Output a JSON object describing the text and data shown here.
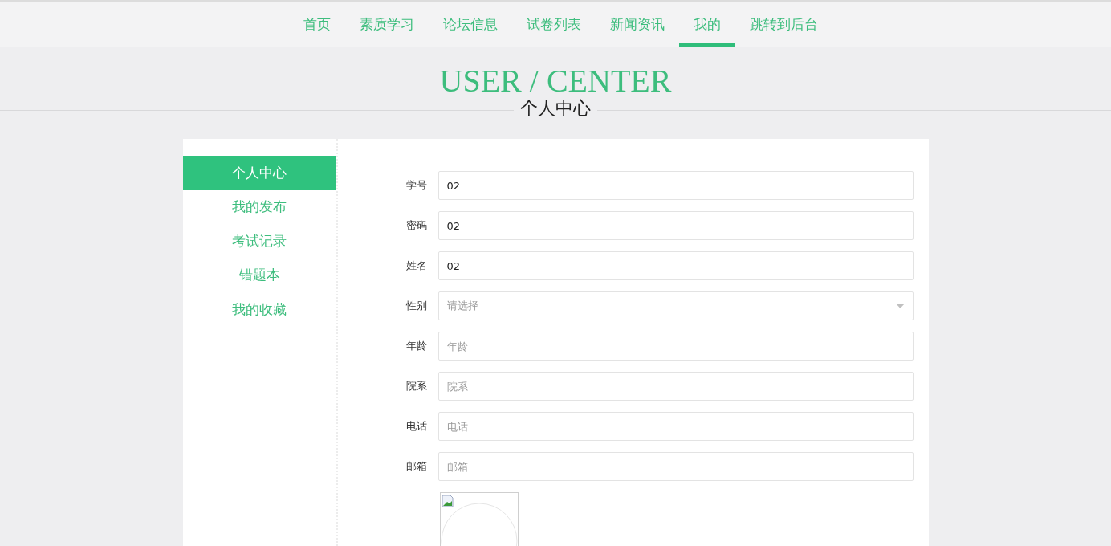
{
  "nav": [
    {
      "label": "首页",
      "selected": false
    },
    {
      "label": "素质学习",
      "selected": false
    },
    {
      "label": "论坛信息",
      "selected": false
    },
    {
      "label": "试卷列表",
      "selected": false
    },
    {
      "label": "新闻资讯",
      "selected": false
    },
    {
      "label": "我的",
      "selected": true
    },
    {
      "label": "跳转到后台",
      "selected": false
    }
  ],
  "header": {
    "title": "USER / CENTER",
    "subtitle": "个人中心"
  },
  "sidebar": {
    "items": [
      {
        "label": "个人中心",
        "selected": true
      },
      {
        "label": "我的发布",
        "selected": false
      },
      {
        "label": "考试记录",
        "selected": false
      },
      {
        "label": "错题本",
        "selected": false
      },
      {
        "label": "我的收藏",
        "selected": false
      }
    ]
  },
  "form": {
    "fields": [
      {
        "kind": "input",
        "label": "学号",
        "value": "02"
      },
      {
        "kind": "input",
        "label": "密码",
        "value": "02"
      },
      {
        "kind": "input",
        "label": "姓名",
        "value": "02"
      },
      {
        "kind": "select",
        "label": "性别",
        "placeholder": "请选择"
      },
      {
        "kind": "input",
        "label": "年龄",
        "placeholder": "年龄"
      },
      {
        "kind": "input",
        "label": "院系",
        "placeholder": "院系"
      },
      {
        "kind": "input",
        "label": "电话",
        "placeholder": "电话"
      },
      {
        "kind": "input",
        "label": "邮箱",
        "placeholder": "邮箱"
      }
    ]
  }
}
